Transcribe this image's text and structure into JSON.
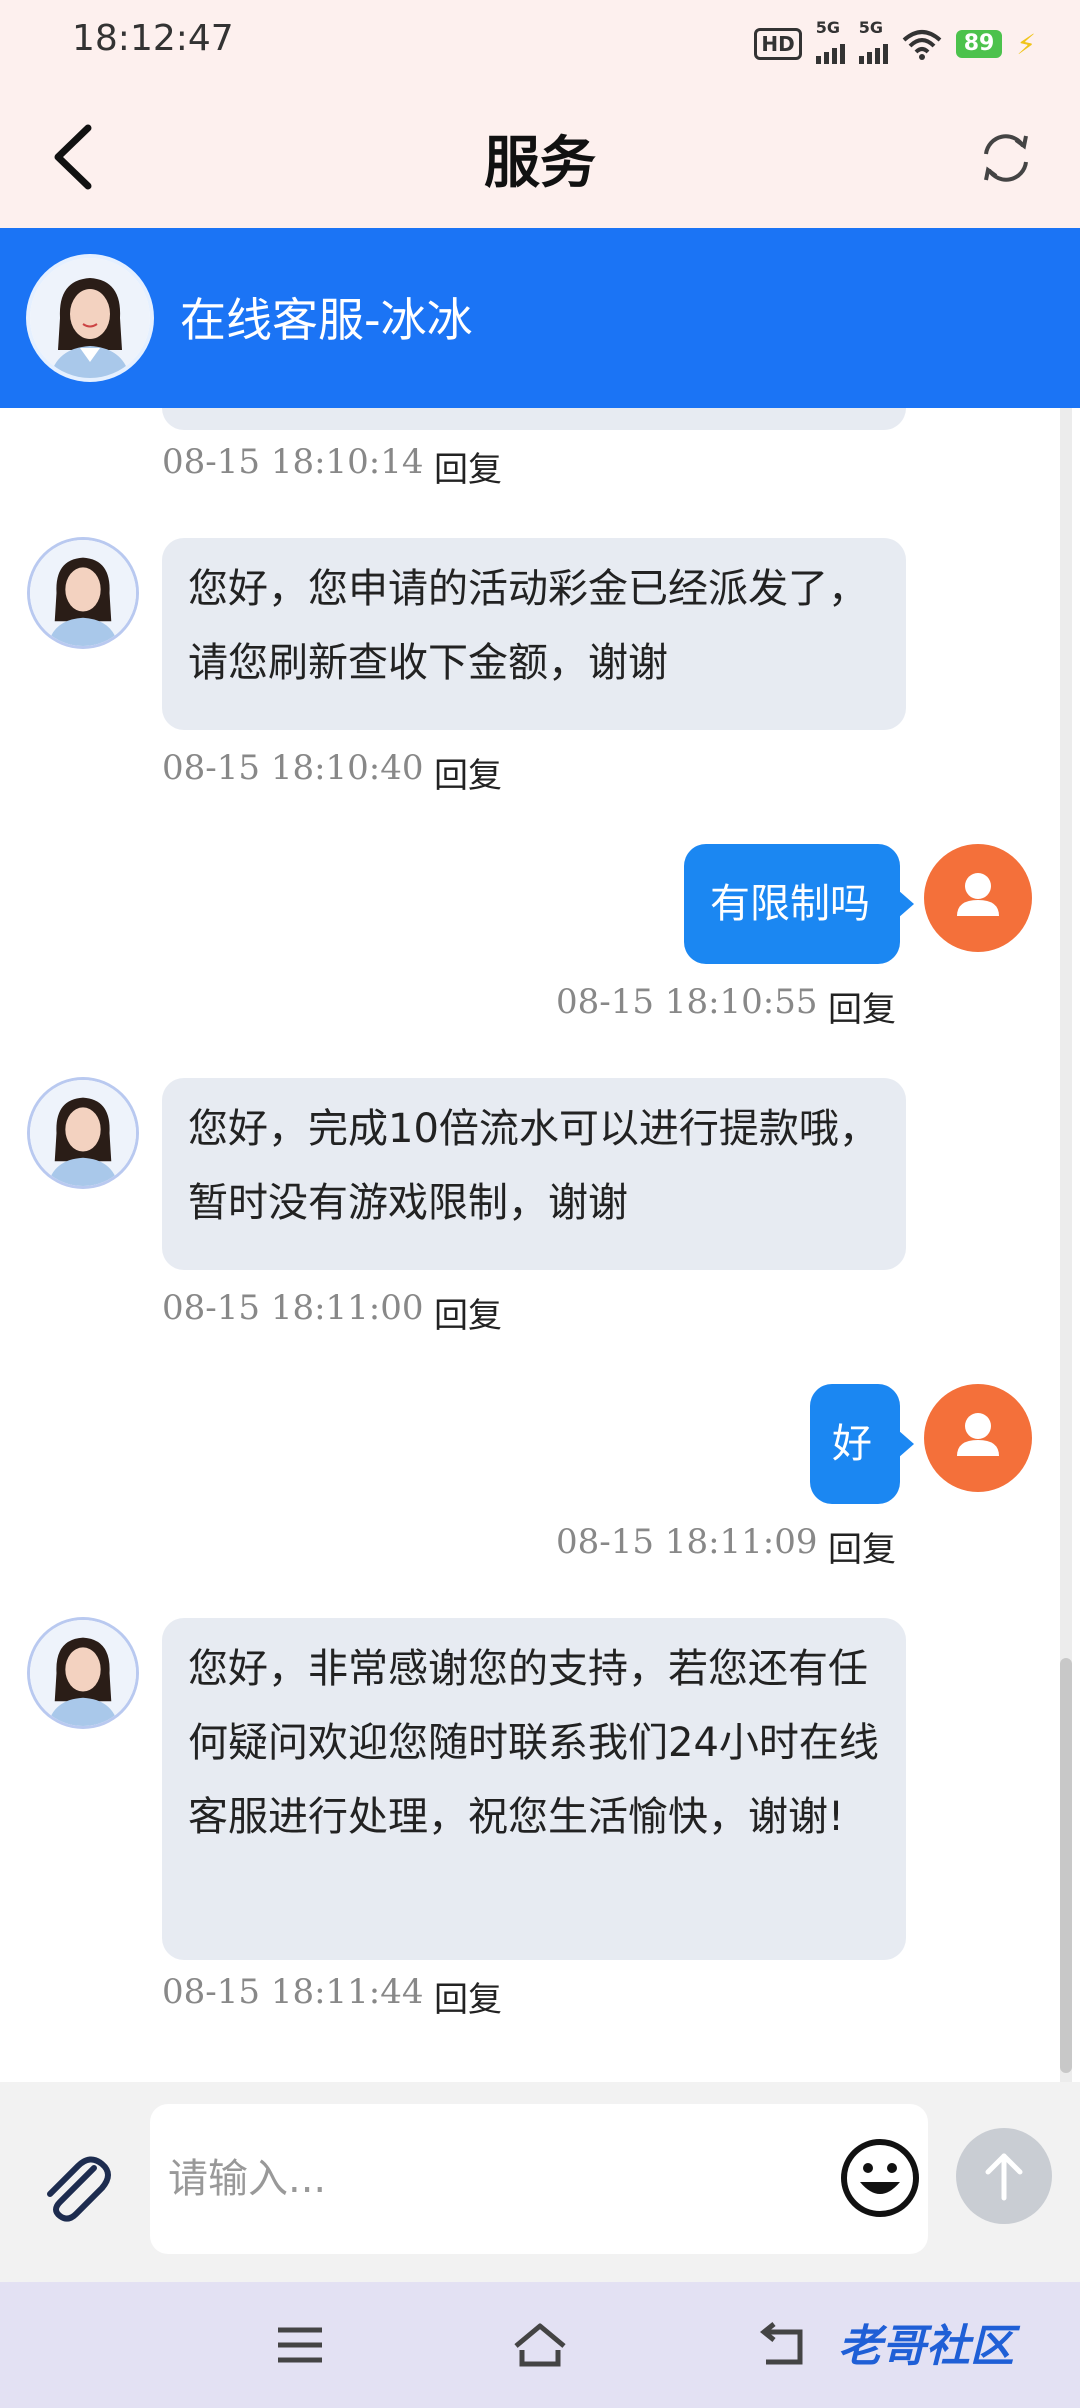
{
  "status_bar": {
    "time": "18:12:47",
    "network_label_1": "5G",
    "network_label_2": "5G",
    "hd_label": "HD",
    "battery": "89"
  },
  "header": {
    "title": "服务"
  },
  "agent": {
    "name": "在线客服-冰冰"
  },
  "messages": [
    {
      "side": "left",
      "text": "",
      "time": "08-15 18:10:14",
      "reply": "回复"
    },
    {
      "side": "left",
      "text": "您好，您申请的活动彩金已经派发了，请您刷新查收下金额，谢谢",
      "time": "08-15 18:10:40",
      "reply": "回复"
    },
    {
      "side": "right",
      "text": "有限制吗",
      "time": "08-15 18:10:55",
      "reply": "回复"
    },
    {
      "side": "left",
      "text": "您好，完成10倍流水可以进行提款哦，暂时没有游戏限制，谢谢",
      "time": "08-15 18:11:00",
      "reply": "回复"
    },
    {
      "side": "right",
      "text": "好",
      "time": "08-15 18:11:09",
      "reply": "回复"
    },
    {
      "side": "left",
      "text": "您好，非常感谢您的支持，若您还有任何疑问欢迎您随时联系我们24小时在线客服进行处理，祝您生活愉快，谢谢!",
      "time": "08-15 18:11:44",
      "reply": "回复"
    }
  ],
  "input": {
    "placeholder": "请输入..."
  },
  "watermark": "老哥社区",
  "colors": {
    "primary": "#1b74f5",
    "user_bubble": "#1b87f2",
    "user_avatar": "#f4703a",
    "agent_bubble": "#e7ebf2"
  }
}
